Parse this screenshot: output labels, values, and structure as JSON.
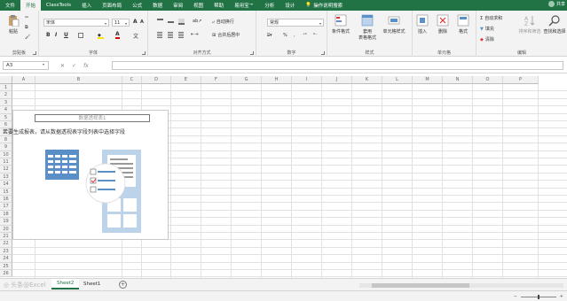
{
  "tabs": [
    "文件",
    "开始",
    "ClassTools",
    "插入",
    "页面布局",
    "公式",
    "数据",
    "审阅",
    "视图",
    "帮助",
    "易用宝™",
    "分析",
    "设计"
  ],
  "active_tab": "开始",
  "tell_me": "操作说明搜索",
  "user": "共享",
  "ribbon": {
    "clipboard": {
      "label": "剪贴板",
      "paste": "粘贴"
    },
    "font": {
      "label": "字体",
      "font_name": "宋体",
      "font_size": "11",
      "bold": "B",
      "italic": "I",
      "underline": "U",
      "grow": "A",
      "shrink": "A",
      "wen": "文"
    },
    "alignment": {
      "label": "对齐方式",
      "wrap": "自动换行",
      "merge": "合并后居中"
    },
    "number": {
      "label": "数字",
      "format": "常规",
      "percent": "%",
      "comma": ","
    },
    "styles": {
      "label": "样式",
      "conditional": "条件格式",
      "table": "套用\n表格格式",
      "cell_styles": "单元格样式"
    },
    "cells": {
      "label": "单元格",
      "insert": "插入",
      "delete": "删除",
      "format": "格式"
    },
    "editing": {
      "label": "编辑",
      "autosum": "自动求和",
      "fill": "填充",
      "clear": "清除",
      "sort": "排序和筛选",
      "find": "查找和选择"
    }
  },
  "formula_bar": {
    "name_box": "A3",
    "cancel": "✕",
    "enter": "✓",
    "fx": "fx",
    "value": ""
  },
  "columns": [
    "A",
    "B",
    "C",
    "D",
    "E",
    "F",
    "G",
    "H",
    "I",
    "J",
    "K",
    "L",
    "M",
    "N",
    "O",
    "P"
  ],
  "rows": [
    "1",
    "2",
    "3",
    "4",
    "5",
    "6",
    "7",
    "8",
    "9",
    "10",
    "11",
    "12",
    "13",
    "14",
    "15",
    "16",
    "17",
    "18",
    "19",
    "20",
    "21",
    "22",
    "23",
    "24",
    "25",
    "26"
  ],
  "pivot": {
    "title": "数据透视表1",
    "message": "若要生成报表，请从数据透视表字段列表中选择字段"
  },
  "sheets": [
    "Sheet2",
    "Sheet1"
  ],
  "active_sheet": "Sheet2",
  "colors": {
    "accent": "#217346",
    "icon_blue": "#5b8fc7",
    "icon_light": "#bcd3ea"
  },
  "watermark": "头条@Excel"
}
